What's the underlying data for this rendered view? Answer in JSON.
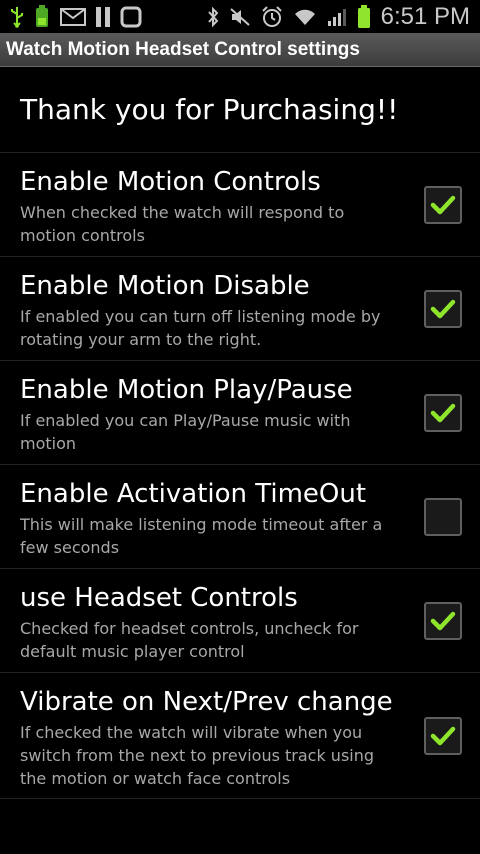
{
  "status_bar": {
    "time": "6:51 PM",
    "left_icons": [
      "usb-icon",
      "battery-saver-icon",
      "mail-icon",
      "pause-icon",
      "square-icon"
    ],
    "right_icons": [
      "bluetooth-icon",
      "mute-icon",
      "alarm-icon",
      "wifi-icon",
      "signal-icon",
      "battery-icon"
    ],
    "accent": "#8ee52c"
  },
  "app_bar": {
    "title": "Watch Motion Headset Control settings"
  },
  "header": {
    "text": "Thank you for Purchasing!!"
  },
  "preferences": [
    {
      "title": "Enable Motion Controls",
      "summary": "When checked the watch will respond to motion controls",
      "checked": true
    },
    {
      "title": "Enable Motion Disable",
      "summary": "If enabled you can turn off listening mode by rotating your arm to the right.",
      "checked": true
    },
    {
      "title": "Enable Motion Play/Pause",
      "summary": "If enabled you can Play/Pause music with motion",
      "checked": true
    },
    {
      "title": "Enable Activation TimeOut",
      "summary": "This will make listening mode timeout after a few seconds",
      "checked": false
    },
    {
      "title": "use Headset Controls",
      "summary": "Checked for headset controls, uncheck for default music player control",
      "checked": true
    },
    {
      "title": "Vibrate on Next/Prev change",
      "summary": "If checked the watch will vibrate when you switch from the next to previous track using the motion or watch face controls",
      "checked": true
    }
  ],
  "colors": {
    "check_green": "#8ee52c",
    "summary_gray": "#a8a8a8",
    "background": "#000000"
  }
}
